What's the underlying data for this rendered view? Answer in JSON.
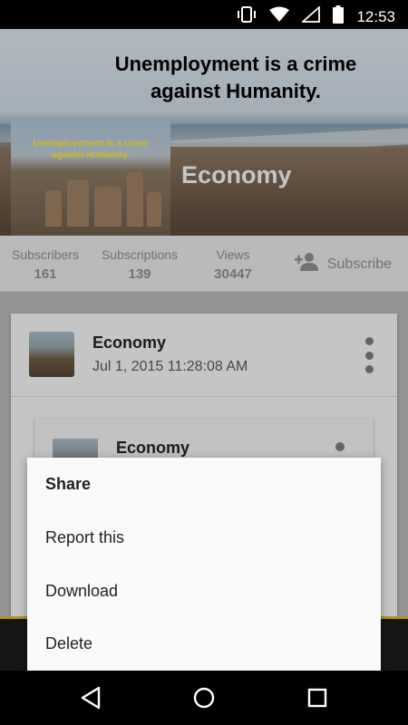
{
  "status_bar": {
    "time": "12:53",
    "icons": [
      "vibrate-icon",
      "wifi-icon",
      "signal-icon",
      "battery-icon"
    ]
  },
  "banner": {
    "headline_line1": "Unemployment is a crime",
    "headline_line2": "against Humanity.",
    "thumb_text_line1": "Unemployement is a crime",
    "thumb_text_line2": "against Humanity.",
    "channel_name": "Economy"
  },
  "stats": {
    "subscribers_label": "Subscribers",
    "subscribers_value": "161",
    "subscriptions_label": "Subscriptions",
    "subscriptions_value": "139",
    "views_label": "Views",
    "views_value": "30447",
    "subscribe_label": "Subscribe"
  },
  "post": {
    "title": "Economy",
    "date": "Jul 1, 2015 11:28:08 AM",
    "inner_title": "Economy"
  },
  "menu": {
    "items": [
      {
        "label": "Share"
      },
      {
        "label": "Report this"
      },
      {
        "label": "Download"
      },
      {
        "label": "Delete"
      }
    ]
  },
  "colors": {
    "accent": "#d8b52a",
    "thumb_text": "#f4e32a"
  }
}
